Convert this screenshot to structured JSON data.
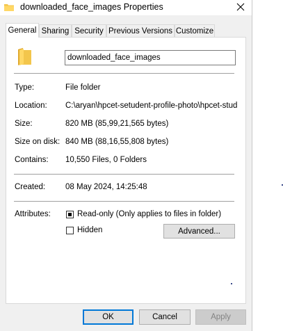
{
  "window": {
    "title": "downloaded_face_images Properties"
  },
  "tabs": [
    {
      "label": "General",
      "active": true
    },
    {
      "label": "Sharing"
    },
    {
      "label": "Security"
    },
    {
      "label": "Previous Versions"
    },
    {
      "label": "Customize"
    }
  ],
  "general": {
    "name_value": "downloaded_face_images",
    "type_label": "Type:",
    "type_value": "File folder",
    "location_label": "Location:",
    "location_value": "C:\\aryan\\hpcet-setudent-profile-photo\\hpcet-student",
    "size_label": "Size:",
    "size_value": "820 MB (85,99,21,565 bytes)",
    "size_on_disk_label": "Size on disk:",
    "size_on_disk_value": "840 MB (88,16,55,808 bytes)",
    "contains_label": "Contains:",
    "contains_value": "10,550 Files, 0 Folders",
    "created_label": "Created:",
    "created_value": "08 May 2024, 14:25:48",
    "attributes_label": "Attributes:",
    "readonly_label": "Read-only (Only applies to files in folder)",
    "readonly_state": "indeterminate",
    "hidden_label": "Hidden",
    "hidden_checked": false,
    "advanced_label": "Advanced..."
  },
  "footer": {
    "ok_label": "OK",
    "cancel_label": "Cancel",
    "apply_label": "Apply"
  },
  "colors": {
    "folder": "#f3c64c",
    "accent": "#0078d7"
  }
}
